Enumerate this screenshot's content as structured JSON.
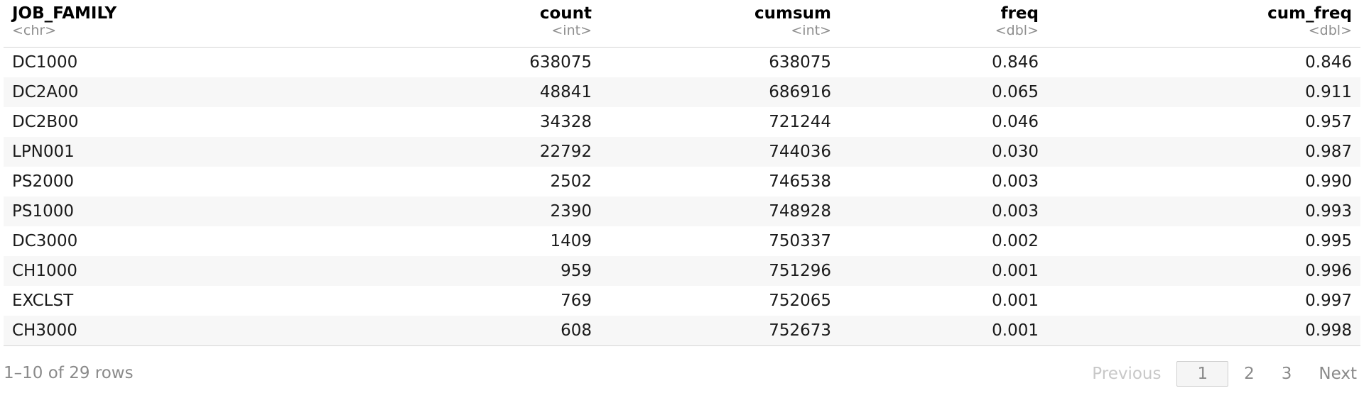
{
  "table": {
    "columns": [
      {
        "name": "JOB_FAMILY",
        "type": "<chr>"
      },
      {
        "name": "count",
        "type": "<int>"
      },
      {
        "name": "cumsum",
        "type": "<int>"
      },
      {
        "name": "freq",
        "type": "<dbl>"
      },
      {
        "name": "cum_freq",
        "type": "<dbl>"
      }
    ],
    "rows": [
      [
        "DC1000",
        "638075",
        "638075",
        "0.846",
        "0.846"
      ],
      [
        "DC2A00",
        "48841",
        "686916",
        "0.065",
        "0.911"
      ],
      [
        "DC2B00",
        "34328",
        "721244",
        "0.046",
        "0.957"
      ],
      [
        "LPN001",
        "22792",
        "744036",
        "0.030",
        "0.987"
      ],
      [
        "PS2000",
        "2502",
        "746538",
        "0.003",
        "0.990"
      ],
      [
        "PS1000",
        "2390",
        "748928",
        "0.003",
        "0.993"
      ],
      [
        "DC3000",
        "1409",
        "750337",
        "0.002",
        "0.995"
      ],
      [
        "CH1000",
        "959",
        "751296",
        "0.001",
        "0.996"
      ],
      [
        "EXCLST",
        "769",
        "752065",
        "0.001",
        "0.997"
      ],
      [
        "CH3000",
        "608",
        "752673",
        "0.001",
        "0.998"
      ]
    ]
  },
  "footer": {
    "row_info": "1–10 of 29 rows",
    "previous_label": "Previous",
    "pages": [
      "1",
      "2",
      "3"
    ],
    "current_page": "1",
    "next_label": "Next"
  }
}
